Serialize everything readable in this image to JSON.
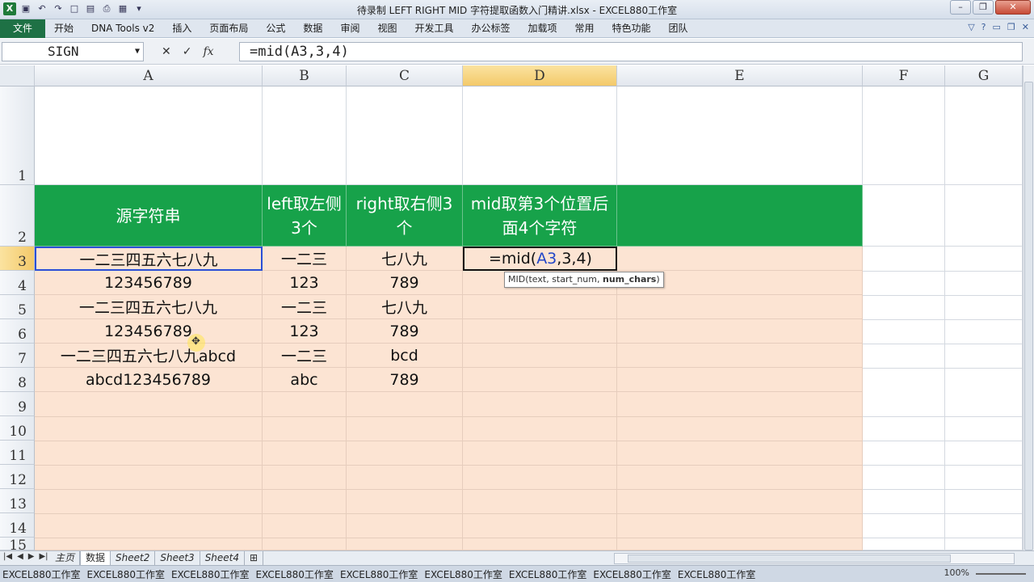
{
  "window": {
    "title": "待录制 LEFT RIGHT MID 字符提取函数入门精讲.xlsx - EXCEL880工作室",
    "qat_icons": [
      "excel-logo-icon",
      "save-icon",
      "undo-icon",
      "redo-icon",
      "new-icon",
      "open-icon",
      "print-icon",
      "preview-icon",
      "customize-icon"
    ],
    "excel_logo_text": "X",
    "buttons": [
      "minimize-icon",
      "restore-icon",
      "close-icon"
    ]
  },
  "ribbon": {
    "file": "文件",
    "tabs": [
      "开始",
      "DNA Tools v2",
      "插入",
      "页面布局",
      "公式",
      "数据",
      "审阅",
      "视图",
      "开发工具",
      "办公标签",
      "加载项",
      "常用",
      "特色功能",
      "团队"
    ]
  },
  "formula_bar": {
    "name_box": "SIGN",
    "formula": "=mid(A3,3,4)",
    "cancel_glyph": "✕",
    "enter_glyph": "✓",
    "fx_glyph": "fx"
  },
  "columns": [
    "A",
    "B",
    "C",
    "D",
    "E",
    "F",
    "G"
  ],
  "rows": [
    "1",
    "2",
    "3",
    "4",
    "5",
    "6",
    "7",
    "8",
    "9",
    "10",
    "11",
    "12",
    "13",
    "14",
    "15"
  ],
  "table": {
    "headers": {
      "a": "源字符串",
      "b": "left取左侧3个",
      "c": "right取右侧3个",
      "d": "mid取第3个位置后面4个字符"
    },
    "rows": [
      {
        "a": "一二三四五六七八九",
        "b": "一二三",
        "c": "七八九"
      },
      {
        "a": "123456789",
        "b": "123",
        "c": "789"
      },
      {
        "a": "一二三四五六七八九",
        "b": "一二三",
        "c": "七八九"
      },
      {
        "a": "123456789",
        "b": "123",
        "c": "789"
      },
      {
        "a": "一二三四五六七八九abcd",
        "b": "一二三",
        "c": "bcd"
      },
      {
        "a": "abcd123456789",
        "b": "abc",
        "c": "789"
      }
    ],
    "editing": {
      "prefix": "=mid(",
      "ref": "A3",
      "suffix": ",3,4)"
    }
  },
  "tooltip": {
    "fn": "MID(text, start_num, ",
    "bold_arg": "num_chars",
    "close": ")"
  },
  "sheets": [
    "主页",
    "数据",
    "Sheet2",
    "Sheet3",
    "Sheet4"
  ],
  "active_sheet": "数据",
  "taskbar": [
    "EXCEL880工作室",
    "EXCEL880工作室",
    "EXCEL880工作室",
    "EXCEL880工作室",
    "EXCEL880工作室",
    "EXCEL880工作室",
    "EXCEL880工作室",
    "EXCEL880工作室",
    "EXCEL880工作室"
  ],
  "zoom": "100%",
  "colors": {
    "header_green": "#17a24a",
    "cell_peach": "#fce4d3",
    "file_tab": "#1e7145",
    "ref_blue": "#2246c8"
  }
}
